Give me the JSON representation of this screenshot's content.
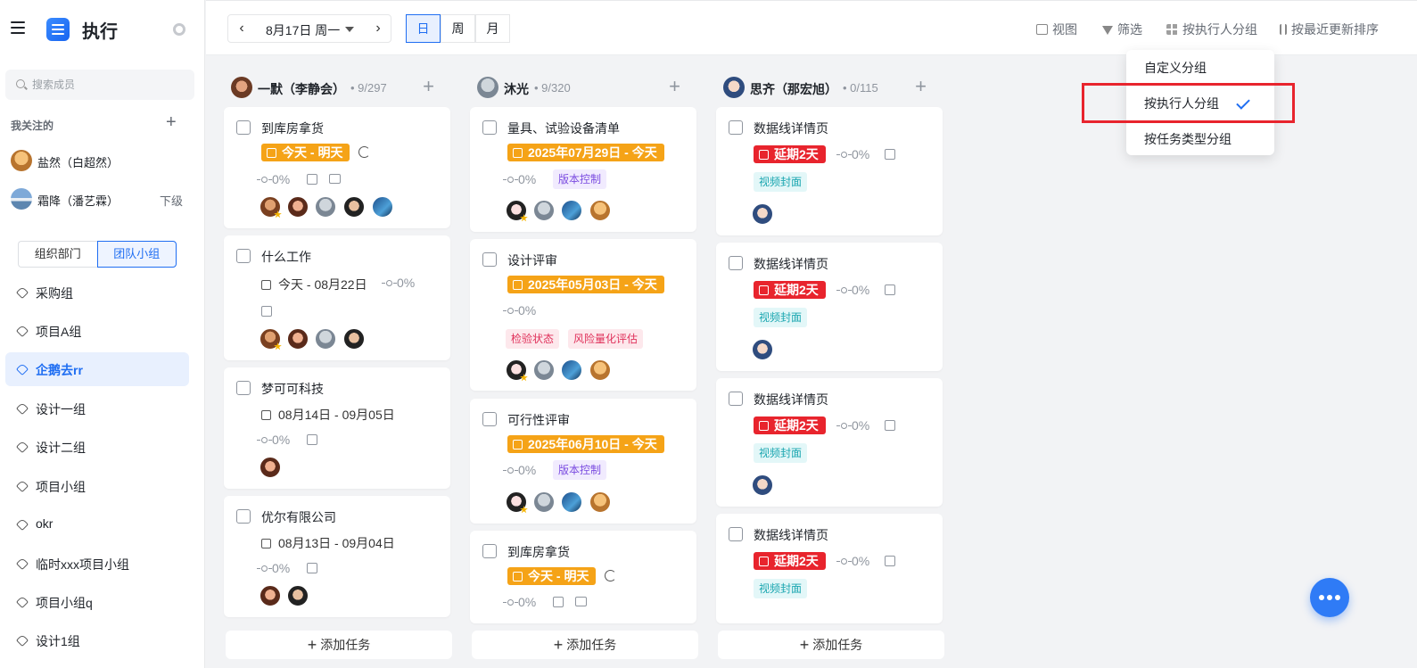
{
  "app": {
    "title": "执行"
  },
  "sidebar": {
    "search_placeholder": "搜索成员",
    "follow_title": "我关注的",
    "members": [
      {
        "name": "盐然（白超然）",
        "sub": ""
      },
      {
        "name": "霜降（潘艺霖）",
        "sub": "下级"
      }
    ],
    "tabs": [
      {
        "label": "组织部门"
      },
      {
        "label": "团队小组"
      }
    ],
    "groups": [
      {
        "label": "采购组"
      },
      {
        "label": "项目A组"
      },
      {
        "label": "企鹅去rr"
      },
      {
        "label": "设计一组"
      },
      {
        "label": "设计二组"
      },
      {
        "label": "项目小组"
      },
      {
        "label": "okr"
      },
      {
        "label": "临时xxx项目小组"
      },
      {
        "label": "项目小组q"
      },
      {
        "label": "设计1组"
      }
    ]
  },
  "topbar": {
    "date": "8月17日 周一",
    "prev": "‹",
    "next": "›",
    "ranges": [
      "日",
      "周",
      "月"
    ],
    "view": "视图",
    "filter": "筛选",
    "group_by": "按执行人分组",
    "sort": "按最近更新排序"
  },
  "dropdown": {
    "items": [
      {
        "label": "自定义分组"
      },
      {
        "label": "按执行人分组"
      },
      {
        "label": "按任务类型分组"
      }
    ],
    "selected_index": 1
  },
  "columns": [
    {
      "name": "一默（李静会）",
      "count": "• 9/297",
      "cards": [
        {
          "title": "到库房拿货",
          "date": "今天 - 明天",
          "progress": "0%"
        },
        {
          "title": "什么工作",
          "date": "今天 - 08月22日",
          "progress": "0%"
        },
        {
          "title": "梦可可科技",
          "date": "08月14日 - 09月05日",
          "progress": "0%"
        },
        {
          "title": "优尔有限公司",
          "date": "08月13日 - 09月04日",
          "progress": "0%"
        }
      ],
      "add": "添加任务"
    },
    {
      "name": "沐光",
      "count": "• 9/320",
      "cards": [
        {
          "title": "量具、试验设备清单",
          "date": "2025年07月29日 - 今天",
          "progress": "0%",
          "labels": [
            "版本控制"
          ]
        },
        {
          "title": "设计评审",
          "date": "2025年05月03日 - 今天",
          "progress": "0%",
          "labels": [
            "检验状态",
            "风险量化评估"
          ]
        },
        {
          "title": "可行性评审",
          "date": "2025年06月10日 - 今天",
          "progress": "0%",
          "labels": [
            "版本控制"
          ]
        },
        {
          "title": "到库房拿货",
          "date": "今天 - 明天",
          "progress": "0%"
        }
      ],
      "add": "添加任务"
    },
    {
      "name": "思齐（那宏旭）",
      "count": "• 0/115",
      "cards": [
        {
          "title": "数据线详情页",
          "date": "延期2天",
          "progress": "0%",
          "labels": [
            "视频封面"
          ]
        },
        {
          "title": "数据线详情页",
          "date": "延期2天",
          "progress": "0%",
          "labels": [
            "视频封面"
          ]
        },
        {
          "title": "数据线详情页",
          "date": "延期2天",
          "progress": "0%",
          "labels": [
            "视频封面"
          ]
        },
        {
          "title": "数据线详情页",
          "date": "延期2天",
          "progress": "0%",
          "labels": [
            "视频封面"
          ]
        }
      ],
      "add": "添加任务"
    }
  ],
  "colors": {
    "accent": "#1f6ef2",
    "orange": "#f5a317",
    "overdue": "#e8242d",
    "highlight": "#e8242d"
  }
}
